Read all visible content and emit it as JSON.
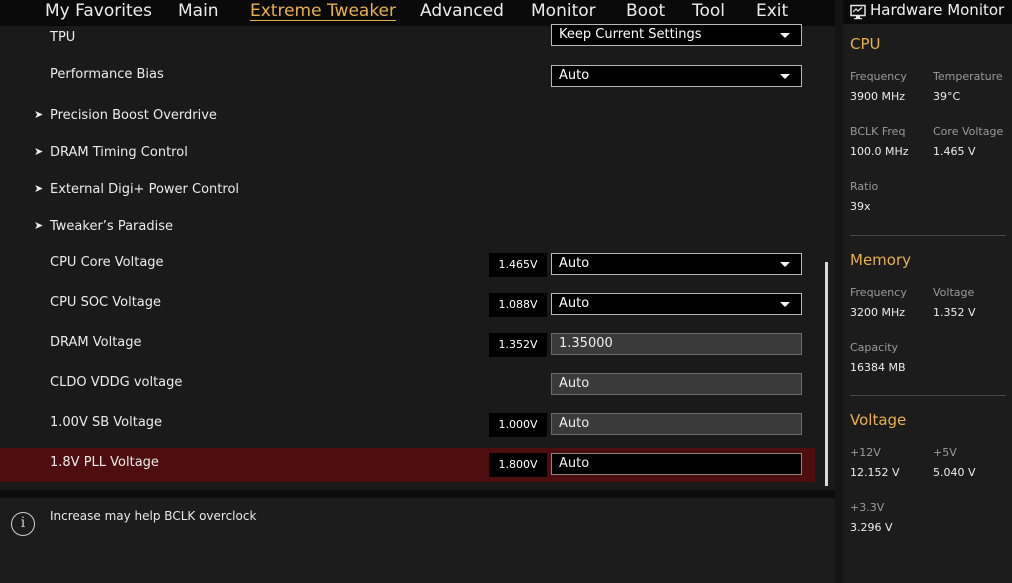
{
  "nav": {
    "tabs": [
      "My Favorites",
      "Main",
      "Extreme Tweaker",
      "Advanced",
      "Monitor",
      "Boot",
      "Tool",
      "Exit"
    ],
    "active": "Extreme Tweaker"
  },
  "settings": [
    {
      "label": "TPU",
      "control": "dropdown",
      "value": "Keep Current Settings"
    },
    {
      "label": "Performance Bias",
      "control": "dropdown",
      "value": "Auto"
    },
    {
      "label": "Precision Boost Overdrive",
      "control": "submenu"
    },
    {
      "label": "DRAM Timing Control",
      "control": "submenu"
    },
    {
      "label": "External Digi+ Power Control",
      "control": "submenu"
    },
    {
      "label": "Tweaker’s Paradise",
      "control": "submenu"
    },
    {
      "label": "CPU Core Voltage",
      "control": "dropdown",
      "current": "1.465V",
      "value": "Auto"
    },
    {
      "label": "CPU SOC Voltage",
      "control": "dropdown",
      "current": "1.088V",
      "value": "Auto"
    },
    {
      "label": "DRAM Voltage",
      "control": "field",
      "current": "1.352V",
      "value": "1.35000"
    },
    {
      "label": "CLDO VDDG voltage",
      "control": "field",
      "value": "Auto"
    },
    {
      "label": "1.00V SB Voltage",
      "control": "field",
      "current": "1.000V",
      "value": "Auto"
    },
    {
      "label": "1.8V PLL Voltage",
      "control": "field",
      "current": "1.800V",
      "value": "Auto",
      "selected": true
    }
  ],
  "help": {
    "text": "Increase may help BCLK overclock",
    "icon": "info-icon"
  },
  "hardware_monitor": {
    "title": "Hardware Monitor",
    "icon": "monitor-icon",
    "cpu": {
      "title": "CPU",
      "frequency_label": "Frequency",
      "frequency": "3900 MHz",
      "temperature_label": "Temperature",
      "temperature": "39°C",
      "bclk_label": "BCLK Freq",
      "bclk": "100.0 MHz",
      "core_voltage_label": "Core Voltage",
      "core_voltage": "1.465 V",
      "ratio_label": "Ratio",
      "ratio": "39x"
    },
    "memory": {
      "title": "Memory",
      "frequency_label": "Frequency",
      "frequency": "3200 MHz",
      "voltage_label": "Voltage",
      "voltage": "1.352 V",
      "capacity_label": "Capacity",
      "capacity": "16384 MB"
    },
    "voltage": {
      "title": "Voltage",
      "v12_label": "+12V",
      "v12": "12.152 V",
      "v5_label": "+5V",
      "v5": "5.040 V",
      "v33_label": "+3.3V",
      "v33": "3.296 V"
    }
  },
  "colors": {
    "accent": "#e8b04a",
    "selected_row": "#4e0d0f",
    "background": "#1a1a1a"
  }
}
